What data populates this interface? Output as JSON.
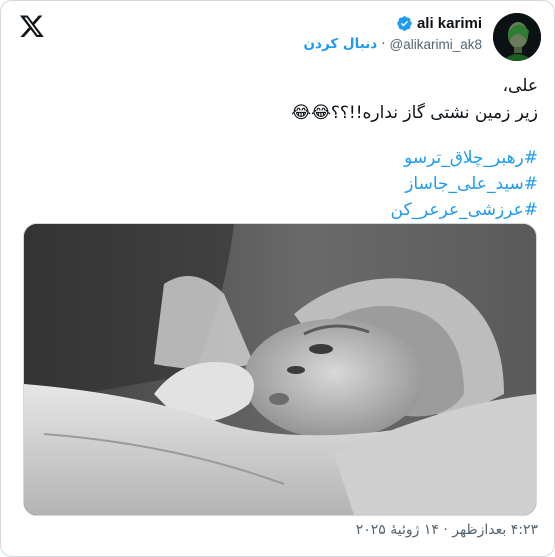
{
  "author": {
    "display_name": "ali karimi",
    "handle": "@alikarimi_ak8",
    "separator": "·",
    "follow_label": "دنبال کردن"
  },
  "tweet": {
    "line1": "علی،",
    "line2": "زیر زمین نشتی  گاز نداره!!؟؟",
    "line2_emoji": "😂😂",
    "hashtags": [
      "#رهبر_چلاق_ترسو",
      "#سید_علی_جاساز",
      "#عرزشی_عرعر_کن"
    ]
  },
  "timestamp": "۴:۲۳ بعدازظهر · ۱۴ ژوئیهٔ ۲۰۲۵",
  "icons": {
    "logo": "x-logo-icon",
    "verified": "verified-badge-icon"
  },
  "colors": {
    "link": "#1d9bf0",
    "text": "#0f1419",
    "muted": "#536471"
  }
}
